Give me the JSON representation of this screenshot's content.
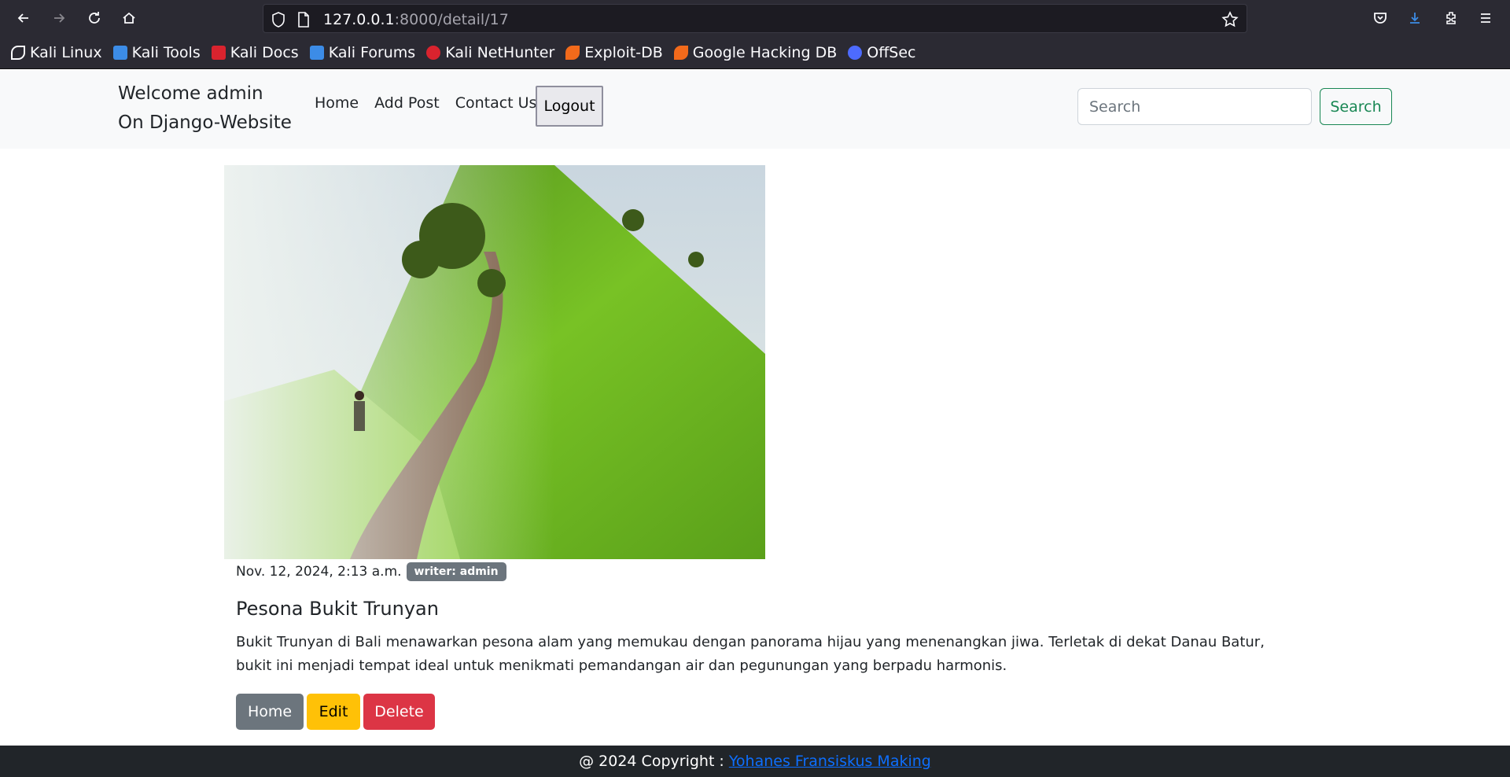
{
  "browser": {
    "url_host": "127.0.0.1",
    "url_rest": ":8000/detail/17",
    "bookmarks": [
      {
        "label": "Kali Linux",
        "color": "#ffffff"
      },
      {
        "label": "Kali Tools",
        "color": "#3c8ce7"
      },
      {
        "label": "Kali Docs",
        "color": "#d9232e"
      },
      {
        "label": "Kali Forums",
        "color": "#3c8ce7"
      },
      {
        "label": "Kali NetHunter",
        "color": "#d9232e"
      },
      {
        "label": "Exploit-DB",
        "color": "#f26a1b"
      },
      {
        "label": "Google Hacking DB",
        "color": "#f26a1b"
      },
      {
        "label": "OffSec",
        "color": "#4d6bfe"
      }
    ]
  },
  "navbar": {
    "brand_line1": "Welcome admin",
    "brand_line2": "On Django-Website",
    "links": [
      "Home",
      "Add Post",
      "Contact Us"
    ],
    "logout_label": "Logout",
    "search_placeholder": "Search",
    "search_button": "Search"
  },
  "post": {
    "date": "Nov. 12, 2024, 2:13 a.m.",
    "writer_badge": "writer: admin",
    "title": "Pesona Bukit Trunyan",
    "body": "Bukit Trunyan di Bali menawarkan pesona alam yang memukau dengan panorama hijau yang menenangkan jiwa. Terletak di dekat Danau Batur, bukit ini menjadi tempat ideal untuk menikmati pemandangan air dan pegunungan yang berpadu harmonis.",
    "buttons": {
      "home": "Home",
      "edit": "Edit",
      "delete": "Delete"
    }
  },
  "footer": {
    "text": "@ 2024 Copyright :",
    "link": "Yohanes Fransiskus Making"
  },
  "colors": {
    "accent_success": "#198754",
    "secondary": "#6c757d",
    "warning": "#ffc107",
    "danger": "#dc3545",
    "link": "#0d6efd"
  }
}
